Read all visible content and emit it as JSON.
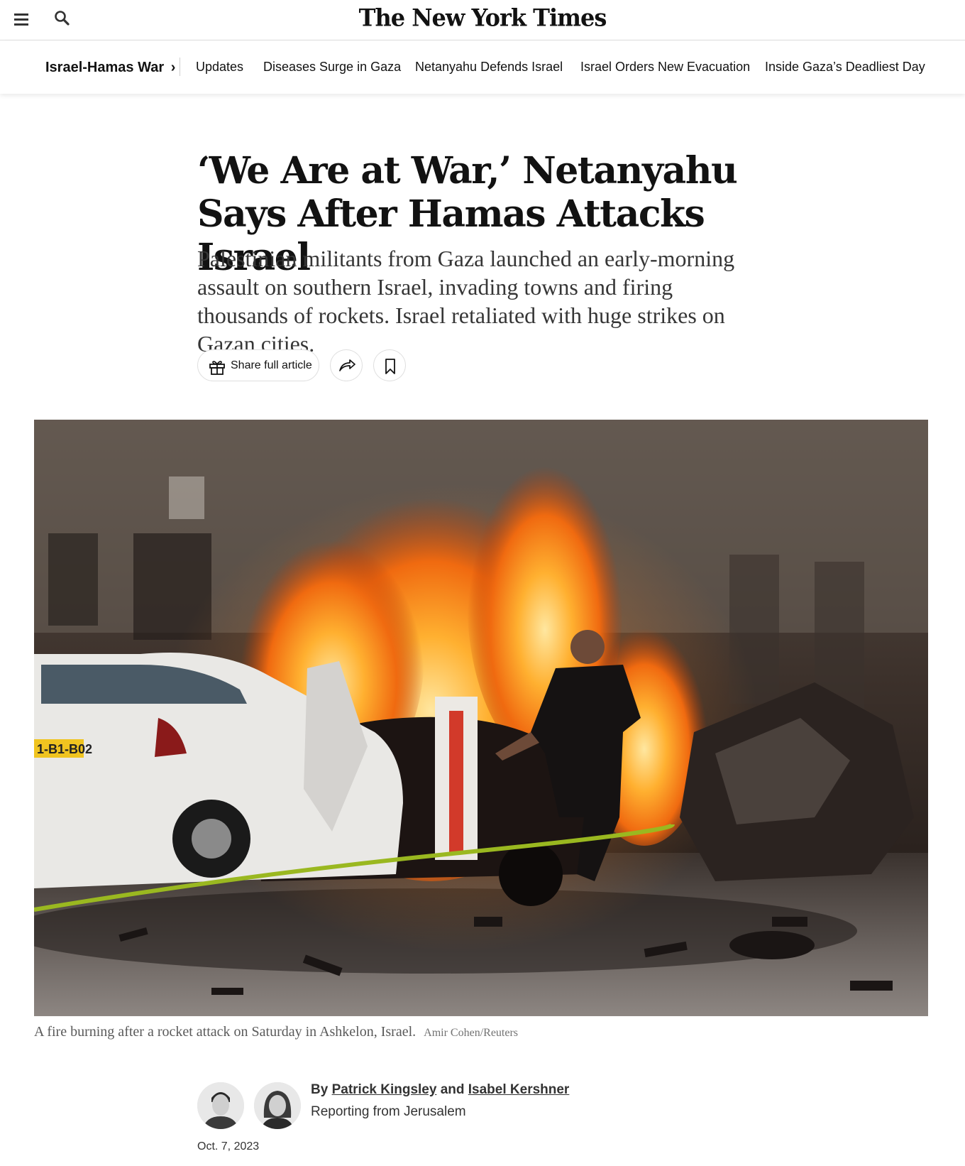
{
  "masthead": {
    "logo_text": "The New York Times",
    "menu_icon": "hamburger-menu-icon",
    "search_icon": "search-icon"
  },
  "section_nav": {
    "section_title": "Israel-Hamas War",
    "links": [
      "Updates",
      "Diseases Surge in Gaza",
      "Netanyahu Defends Israel",
      "Israel Orders New Evacuation",
      "Inside Gaza’s Deadliest Day"
    ]
  },
  "article": {
    "headline": "‘We Are at War,’ Netanyahu Says After Hamas Attacks Israel",
    "summary": "Palestinian militants from Gaza launched an early-morning assault on southern Israel, invading towns and firing thousands of rockets. Israel retaliated with huge strikes on Gazan cities.",
    "share_label": "Share full article",
    "photo_caption": "A fire burning after a rocket attack on Saturday in Ashkelon, Israel.",
    "photo_credit": "Amir Cohen/Reuters",
    "plate_text": "1-B1-B02",
    "byline_prefix": "By",
    "author_1": "Patrick Kingsley",
    "byline_and": "and",
    "author_2": "Isabel Kershner",
    "reporting_from": "Reporting from Jerusalem",
    "date": "Oct. 7, 2023"
  }
}
